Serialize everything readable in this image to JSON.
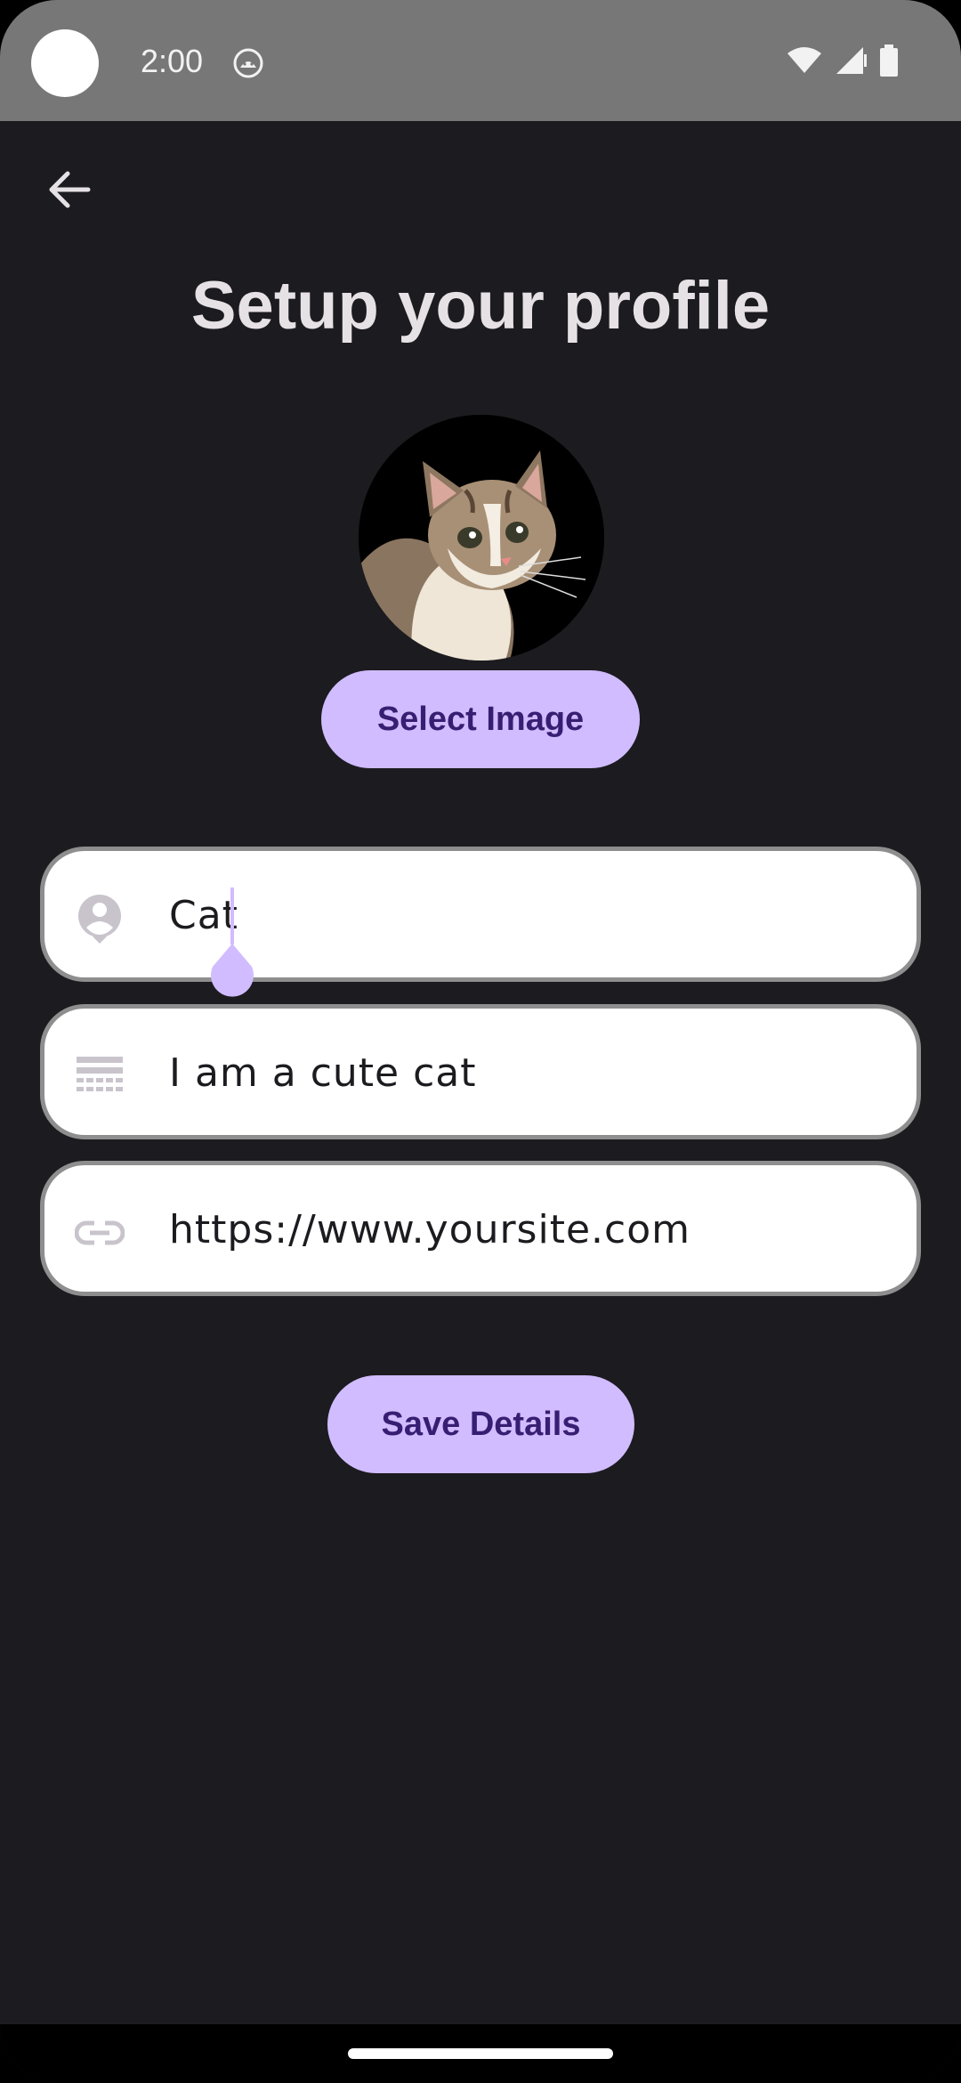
{
  "status_bar": {
    "time": "2:00",
    "app_icon": "android-head-icon",
    "icons": [
      "wifi-icon",
      "signal-icon",
      "battery-icon"
    ]
  },
  "app_bar": {
    "back_icon": "arrow-back-icon"
  },
  "page": {
    "title": "Setup your profile"
  },
  "avatar": {
    "icon": "cat-photo"
  },
  "buttons": {
    "select_image": "Select Image",
    "save_details": "Save Details"
  },
  "fields": [
    {
      "icon": "person-pin-icon",
      "value": "Cat"
    },
    {
      "icon": "notes-icon",
      "value": "I am a cute cat"
    },
    {
      "icon": "link-icon",
      "value": "https://www.yoursite.com"
    }
  ],
  "colors": {
    "background": "#1c1b1f",
    "accent": "#d0bcff",
    "on_accent": "#381e72",
    "status_bar": "#777777"
  }
}
